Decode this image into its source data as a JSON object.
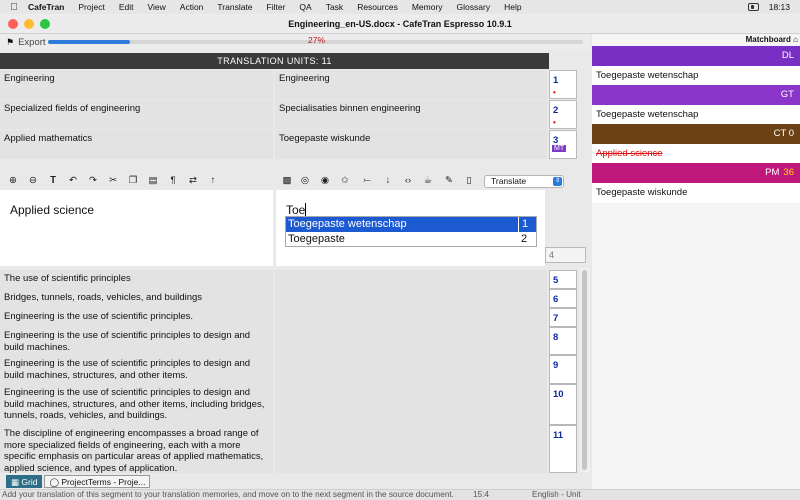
{
  "menubar": {
    "app": "CafeTran",
    "items": [
      "Project",
      "Edit",
      "View",
      "Action",
      "Translate",
      "Filter",
      "QA",
      "Task",
      "Resources",
      "Memory",
      "Glossary",
      "Help"
    ],
    "time": "18:13"
  },
  "window": {
    "title": "Engineering_en-US.docx - CafeTran Espresso 10.9.1"
  },
  "export": {
    "label": "Export",
    "progress_text": "27%",
    "progress": 0.27
  },
  "grid": {
    "header": "TRANSLATION UNITS: 11",
    "upper_rows": [
      {
        "source": "Engineering",
        "target": "Engineering",
        "num": "1",
        "flag": "dot"
      },
      {
        "source": "Specialized fields of engineering",
        "target": "Specialisaties binnen engineering",
        "num": "2",
        "flag": "dot"
      },
      {
        "source": "Applied mathematics",
        "target": "Toegepaste wiskunde",
        "num": "3",
        "flag": "MT"
      }
    ],
    "lower_rows": [
      {
        "source": "The use of scientific principles",
        "target": "",
        "num": "5"
      },
      {
        "source": "Bridges, tunnels, roads, vehicles, and buildings",
        "target": "",
        "num": "6"
      },
      {
        "source": "Engineering is the use of scientific principles.",
        "target": "",
        "num": "7"
      },
      {
        "source": "Engineering is the use of scientific principles to design and build machines.",
        "target": "",
        "num": "8"
      },
      {
        "source": "Engineering is the use of scientific principles to design and build machines, structures, and other items.",
        "target": "",
        "num": "9"
      },
      {
        "source": "Engineering is the use of scientific principles to design and build machines, structures, and other items, including bridges, tunnels, roads, vehicles, and buildings.",
        "target": "",
        "num": "10"
      },
      {
        "source": "The discipline of engineering encompasses a broad range of more specialized fields of engineering, each with a more specific emphasis on particular areas of applied mathematics, applied science, and types of application.",
        "target": "",
        "num": "11"
      }
    ]
  },
  "toolbar": {
    "mode": "Translate"
  },
  "editor": {
    "source": "Applied science",
    "target": "Toe",
    "num": "4",
    "autocomplete": [
      {
        "text": "Toegepaste wetenschap",
        "key": "1"
      },
      {
        "text": "Toegepaste",
        "key": "2"
      }
    ]
  },
  "tabs": [
    {
      "label": "Grid"
    },
    {
      "label": "ProjectTerms - Proje..."
    }
  ],
  "status": {
    "message": "Add your translation of this segment to your translation memories, and move on to the next segment in the source document.",
    "position": "15:4",
    "language": "English - Unit"
  },
  "matchboard": {
    "title": "Matchboard",
    "entries": [
      {
        "source": "DL",
        "text": "Toegepaste wetenschap",
        "color": "#7a2fc4"
      },
      {
        "source": "GT",
        "text": "Toegepaste wetenschap",
        "color": "#8a36c9"
      },
      {
        "source": "CT 0",
        "text": "Applied science",
        "color": "#6b4115",
        "strike": true
      },
      {
        "source": "PM",
        "score": "36",
        "text": "Toegepaste wiskunde",
        "color": "#c0187a"
      }
    ]
  },
  "colors": {
    "accent": "#1b5ad1",
    "header_bg": "#3a3a3a",
    "progress": "#2e7bd9",
    "progress_text": "#c0141a"
  }
}
